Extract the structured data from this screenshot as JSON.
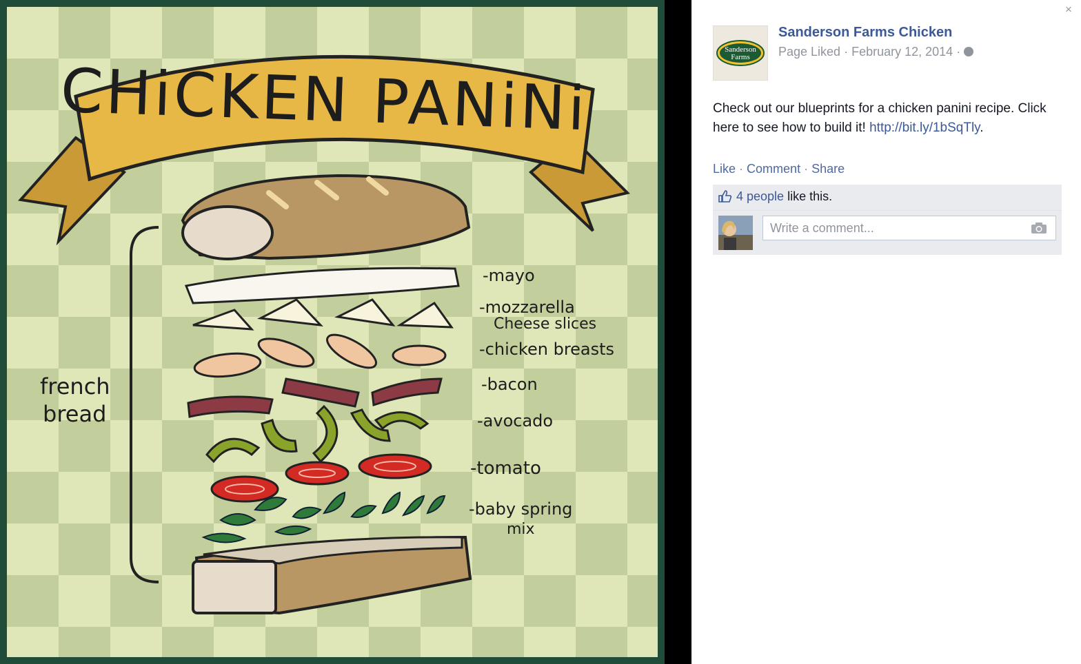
{
  "photo": {
    "title": "CHiCKEN PANiNi",
    "side_label_line1": "french",
    "side_label_line2": "bread",
    "ingredients": {
      "mayo": "-mayo",
      "mozzarella_line1": "-mozzarella",
      "mozzarella_line2": "Cheese slices",
      "chicken": "-chicken breasts",
      "bacon": "-bacon",
      "avocado": "-avocado",
      "tomato": "-tomato",
      "spring_line1": "-baby spring",
      "spring_line2": "mix"
    },
    "colors": {
      "banner": "#e7b845",
      "frame": "#1f4d3a",
      "bread": "#b89765",
      "tomato": "#d42a24",
      "avocado": "#8aa42b"
    }
  },
  "sidebar": {
    "close_icon": "×",
    "page_name": "Sanderson Farms Chicken",
    "logo_line1": "Sanderson",
    "logo_line2": "Farms",
    "status": "Page Liked",
    "date": "February 12, 2014",
    "post_text": "Check out our blueprints for a chicken panini recipe. Click here to see how to build it! ",
    "post_link": "http://bit.ly/1bSqTly",
    "post_text_end": ".",
    "actions": {
      "like": "Like",
      "comment": "Comment",
      "share": "Share"
    },
    "likes_count": "4 people",
    "likes_suffix": " like this.",
    "comment_placeholder": "Write a comment..."
  }
}
